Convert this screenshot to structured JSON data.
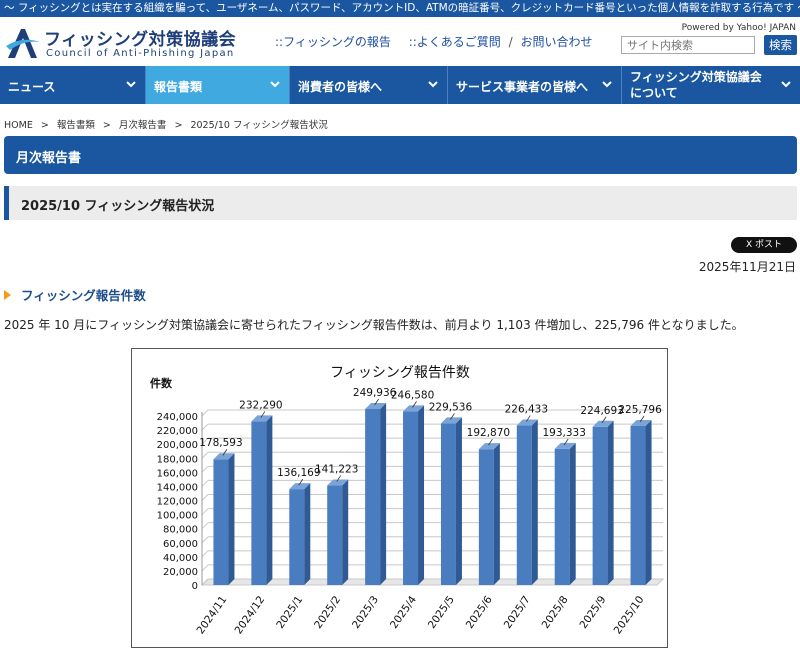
{
  "topbar": {
    "text": "〜 フィッシングとは実在する組織を騙って、ユーザネーム、パスワード、アカウントID、ATMの暗証番号、クレジットカード番号といった個人情報を詐取する行為です 〜"
  },
  "header": {
    "logo_title": "フィッシング対策協議会",
    "logo_sub": "Council of Anti-Phishing Japan",
    "links": [
      "::フィッシングの報告",
      "::よくあるご質問",
      "お問い合わせ"
    ],
    "link_sep": "/",
    "powered": "Powered by Yahoo! JAPAN",
    "search_placeholder": "サイト内検索",
    "search_button": "検索"
  },
  "nav": {
    "items": [
      {
        "label": "ニュース"
      },
      {
        "label": "報告書類"
      },
      {
        "label": "消費者の皆様へ"
      },
      {
        "label": "サービス事業者の皆様へ"
      },
      {
        "label": "フィッシング対策協議会 について"
      }
    ],
    "active_index": 1
  },
  "breadcrumb": [
    "HOME",
    "報告書類",
    "月次報告書",
    "2025/10 フィッシング報告状況"
  ],
  "breadcrumb_sep": ">",
  "page_title": "月次報告書",
  "sub_title": "2025/10 フィッシング報告状況",
  "post_button": "X ポスト",
  "date": "2025年11月21日",
  "section_title": "フィッシング報告件数",
  "lead": "2025 年 10 月にフィッシング対策協議会に寄せられたフィッシング報告件数は、前月より 1,103 件増加し、225,796 件となりました。",
  "colors": {
    "brand": "#1a57a0",
    "nav_active": "#3fa9e0",
    "accent_arrow": "#f39a1f",
    "bar": "#4a7cc0"
  },
  "chart_data": {
    "type": "bar",
    "title": "フィッシング報告件数",
    "ylabel": "件数",
    "xlabel": "",
    "categories": [
      "2024/11",
      "2024/12",
      "2025/1",
      "2025/2",
      "2025/3",
      "2025/4",
      "2025/5",
      "2025/6",
      "2025/7",
      "2025/8",
      "2025/9",
      "2025/10"
    ],
    "values": [
      178593,
      232290,
      136169,
      141223,
      249936,
      246580,
      229536,
      192870,
      226433,
      193333,
      224693,
      225796
    ],
    "value_labels": [
      "178,593",
      "232,290",
      "136,169",
      "141,223",
      "249,936",
      "246,580",
      "229,536",
      "192,870",
      "226,433",
      "193,333",
      "224,693",
      "225,796"
    ],
    "ylim": [
      0,
      240000
    ],
    "yticks": [
      0,
      20000,
      40000,
      60000,
      80000,
      100000,
      120000,
      140000,
      160000,
      180000,
      200000,
      220000,
      240000
    ],
    "ytick_labels": [
      "0",
      "20,000",
      "40,000",
      "60,000",
      "80,000",
      "100,000",
      "120,000",
      "140,000",
      "160,000",
      "180,000",
      "200,000",
      "220,000",
      "240,000"
    ],
    "grid": true,
    "legend": "none"
  }
}
